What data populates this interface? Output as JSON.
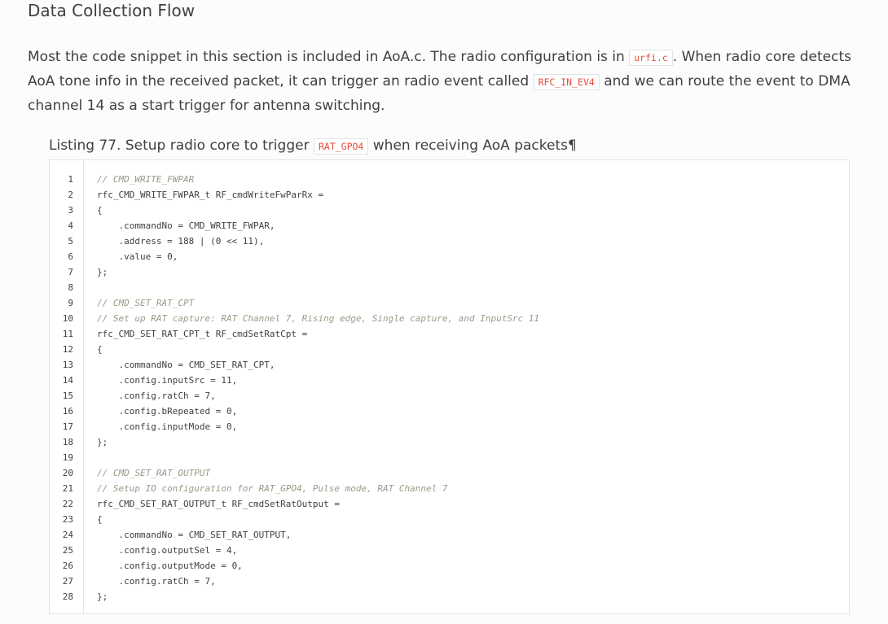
{
  "heading": "Data Collection Flow",
  "paragraph": {
    "t1": "Most the code snippet in this section is included in AoA.c. The radio configuration is in ",
    "code1": "urfi.c",
    "t2": ". When radio core detects AoA tone info in the received packet, it can trigger an radio event called ",
    "code2": "RFC_IN_EV4",
    "t3": " and we can route the event to DMA channel 14 as a start trigger for antenna switching."
  },
  "caption": {
    "prefix": "Listing 77. Setup radio core to trigger ",
    "code": "RAT_GPO4",
    "suffix": " when receiving AoA packets",
    "pilcrow": "¶"
  },
  "code_lines": [
    {
      "n": "1",
      "text": "// CMD_WRITE_FWPAR",
      "kind": "comment"
    },
    {
      "n": "2",
      "text": "rfc_CMD_WRITE_FWPAR_t RF_cmdWriteFwParRx =",
      "kind": "code"
    },
    {
      "n": "3",
      "text": "{",
      "kind": "code"
    },
    {
      "n": "4",
      "text": "    .commandNo = CMD_WRITE_FWPAR,",
      "kind": "code"
    },
    {
      "n": "5",
      "text": "    .address = 188 | (0 << 11),",
      "kind": "code"
    },
    {
      "n": "6",
      "text": "    .value = 0,",
      "kind": "code"
    },
    {
      "n": "7",
      "text": "};",
      "kind": "code"
    },
    {
      "n": "8",
      "text": "",
      "kind": "code"
    },
    {
      "n": "9",
      "text": "// CMD_SET_RAT_CPT",
      "kind": "comment"
    },
    {
      "n": "10",
      "text": "// Set up RAT capture: RAT Channel 7, Rising edge, Single capture, and InputSrc 11",
      "kind": "comment"
    },
    {
      "n": "11",
      "text": "rfc_CMD_SET_RAT_CPT_t RF_cmdSetRatCpt =",
      "kind": "code"
    },
    {
      "n": "12",
      "text": "{",
      "kind": "code"
    },
    {
      "n": "13",
      "text": "    .commandNo = CMD_SET_RAT_CPT,",
      "kind": "code"
    },
    {
      "n": "14",
      "text": "    .config.inputSrc = 11,",
      "kind": "code"
    },
    {
      "n": "15",
      "text": "    .config.ratCh = 7,",
      "kind": "code"
    },
    {
      "n": "16",
      "text": "    .config.bRepeated = 0,",
      "kind": "code"
    },
    {
      "n": "17",
      "text": "    .config.inputMode = 0,",
      "kind": "code"
    },
    {
      "n": "18",
      "text": "};",
      "kind": "code"
    },
    {
      "n": "19",
      "text": "",
      "kind": "code"
    },
    {
      "n": "20",
      "text": "// CMD_SET_RAT_OUTPUT",
      "kind": "comment"
    },
    {
      "n": "21",
      "text": "// Setup IO configuration for RAT_GPO4, Pulse mode, RAT Channel 7",
      "kind": "comment"
    },
    {
      "n": "22",
      "text": "rfc_CMD_SET_RAT_OUTPUT_t RF_cmdSetRatOutput =",
      "kind": "code"
    },
    {
      "n": "23",
      "text": "{",
      "kind": "code"
    },
    {
      "n": "24",
      "text": "    .commandNo = CMD_SET_RAT_OUTPUT,",
      "kind": "code"
    },
    {
      "n": "25",
      "text": "    .config.outputSel = 4,",
      "kind": "code"
    },
    {
      "n": "26",
      "text": "    .config.outputMode = 0,",
      "kind": "code"
    },
    {
      "n": "27",
      "text": "    .config.ratCh = 7,",
      "kind": "code"
    },
    {
      "n": "28",
      "text": "};",
      "kind": "code"
    }
  ]
}
